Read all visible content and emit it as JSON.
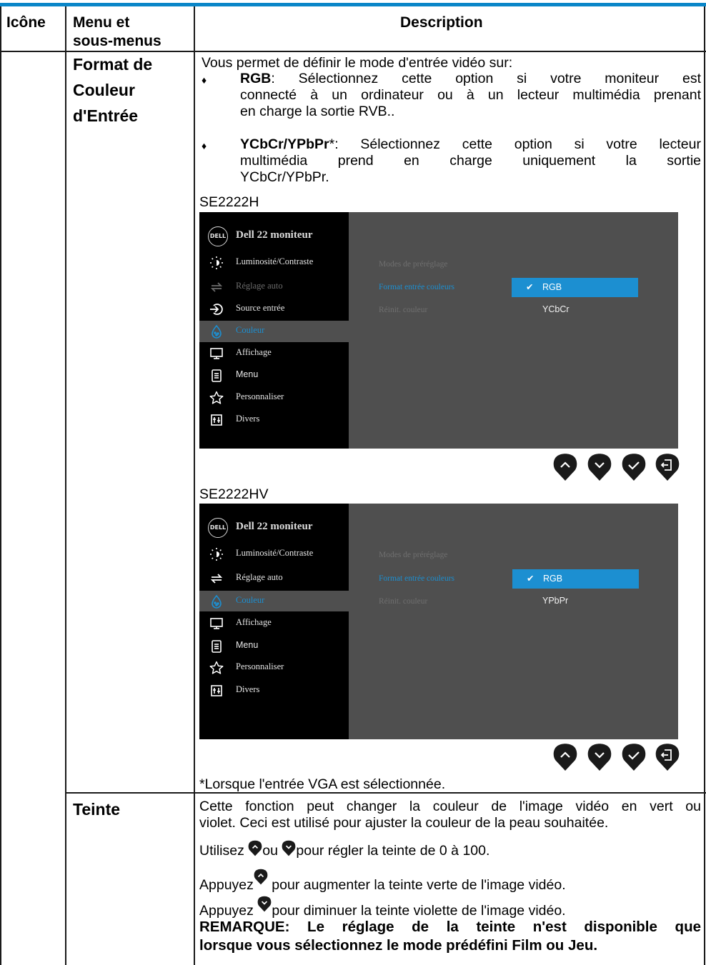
{
  "table": {
    "headers": {
      "icon": "Icône",
      "menu_line1": "Menu et",
      "menu_line2": "sous-menus",
      "description": "Description"
    }
  },
  "row1": {
    "menu_lines": [
      "Format de",
      "Couleur",
      "d'Entrée"
    ],
    "intro": "Vous permet de définir le mode d'entrée vidéo sur:",
    "rgb_label": "RGB",
    "rgb_line1": ": Sélectionnez cette option si votre moniteur est",
    "rgb_line2": "connecté à un ordinateur ou à un lecteur multimédia prenant",
    "rgb_line3": "en charge la sortie RVB..",
    "ycbcr_label": "YCbCr/YPbPr",
    "ycbcr_line1": "*: Sélectionnez cette option si votre lecteur",
    "ycbcr_line2": "multimédia prend en charge uniquement la sortie",
    "ycbcr_line3": "YCbCr/YPbPr.",
    "footnote": "*Lorsque l'entrée VGA est sélectionnée.",
    "screens": [
      {
        "model": "SE2222H",
        "logo": "DELL",
        "title": "Dell 22 moniteur",
        "menu": [
          "Luminosité/Contraste",
          "Réglage auto",
          "Source entrée",
          "Couleur",
          "Affichage",
          "Menu",
          "Personnaliser",
          "Divers"
        ],
        "submenu": [
          "Modes de préréglage",
          "Format entrée couleurs",
          "Réinit. couleur"
        ],
        "selected_option": "RGB",
        "other_option": "YCbCr"
      },
      {
        "model": "SE2222HV",
        "logo": "DELL",
        "title": "Dell 22 moniteur",
        "menu": [
          "Luminosité/Contraste",
          "Réglage auto",
          "Couleur",
          "Affichage",
          "Menu",
          "Personnaliser",
          "Divers"
        ],
        "submenu": [
          "Modes de préréglage",
          "Format entrée couleurs",
          "Réinit. couleur"
        ],
        "selected_option": "RGB",
        "other_option": "YPbPr"
      }
    ]
  },
  "row2": {
    "menu": "Teinte",
    "p1_line1": "Cette fonction peut changer la couleur de l'image vidéo en vert ou",
    "p1_line2": "violet. Ceci est utilisé pour ajuster la couleur de la peau souhaitée.",
    "p2_a": "Utilisez ",
    "p2_b": "ou ",
    "p2_c": "pour régler la teinte de 0 à 100.",
    "p3_a": "Appuyez",
    "p3_b": " pour augmenter la teinte verte de l'image vidéo.",
    "p4_a": "Appuyez ",
    "p4_b": "pour diminuer la teinte violette de l'image vidéo.",
    "note_line1": "REMARQUE: Le réglage de la teinte n'est disponible que",
    "note_line2": "lorsque vous sélectionnez le mode prédéfini Film ou Jeu."
  },
  "colors": {
    "accent": "#1c8fd1",
    "rule": "#0a86c8",
    "osd_bg": "#4f4f4f",
    "button": "#1a1a1a"
  }
}
